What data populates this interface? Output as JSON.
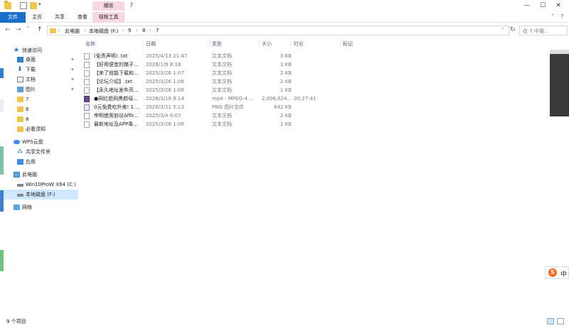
{
  "titlebar": {
    "context_tab": "播放",
    "title": "7",
    "min": "—",
    "max": "☐",
    "close": "✕"
  },
  "ribbon": {
    "tabs": [
      "文件",
      "主页",
      "共享",
      "查看",
      "视频工具"
    ],
    "collapse": "˅",
    "help": "?"
  },
  "address": {
    "back": "←",
    "forward": "→",
    "recent": "˅",
    "up": "↑",
    "crumbs": [
      "此电脑",
      "本地磁盘 (F:)",
      "9",
      "8",
      "7"
    ],
    "sep": "›",
    "dropdown": "˅",
    "refresh": "↻",
    "search_placeholder": "在 7 中搜..."
  },
  "nav": {
    "quick_access": "快速访问",
    "quick_items": [
      {
        "label": "桌面",
        "pinned": true
      },
      {
        "label": "下载",
        "pinned": true
      },
      {
        "label": "文档",
        "pinned": true
      },
      {
        "label": "图片",
        "pinned": true
      },
      {
        "label": "7",
        "pinned": false
      },
      {
        "label": "8",
        "pinned": false
      },
      {
        "label": "8",
        "pinned": false
      },
      {
        "label": "必看须知",
        "pinned": false
      }
    ],
    "pin_glyph": "📌",
    "wps_cloud": "WPS云盘",
    "shared_folder": "共享文件夹",
    "apps": "应用",
    "this_pc": "此电脑",
    "drive_c": "Win10ProW X64 (C:)",
    "drive_f": "本地磁盘 (F:)",
    "network": "网络"
  },
  "columns": [
    "名称",
    "日期",
    "类型",
    "大小",
    "时长",
    "标记"
  ],
  "files": [
    {
      "name": "(免责声明) .txt",
      "date": "2025/4/13 21:47",
      "type": "文本文档",
      "size": "3 KB",
      "duration": "",
      "icon": "txt"
    },
    {
      "name": "【好用便宜的梯子...",
      "date": "2026/1/9 8:18",
      "type": "文本文档",
      "size": "1 KB",
      "duration": "",
      "icon": "txt"
    },
    {
      "name": "【来了就能下载和...",
      "date": "2025/3/26 1:07",
      "type": "文本文档",
      "size": "2 KB",
      "duration": "",
      "icon": "txt"
    },
    {
      "name": "【论坛介绍】.txt",
      "date": "2025/3/26 1:08",
      "type": "文本文档",
      "size": "2 KB",
      "duration": "",
      "icon": "txt"
    },
    {
      "name": "【永久地址发布页...",
      "date": "2025/3/26 1:08",
      "type": "文本文档",
      "size": "1 KB",
      "duration": "",
      "icon": "txt"
    },
    {
      "name": "●网红脸网黑颜母...",
      "date": "2026/3/18 9:14",
      "type": "mp4 - MPEG-4 ...",
      "size": "2,006,624...",
      "duration": "00:27:41",
      "icon": "mp4"
    },
    {
      "name": "0元免费吃外卖! 1 ...",
      "date": "2026/3/11 5:13",
      "type": "PNG 图片文件",
      "size": "642 KB",
      "duration": "",
      "icon": "png"
    },
    {
      "name": "申明使用协议Affir...",
      "date": "2025/3/4 0:07",
      "type": "文本文档",
      "size": "2 KB",
      "duration": "",
      "icon": "txt"
    },
    {
      "name": "最新地址及APP毒...",
      "date": "2025/3/26 1:08",
      "type": "文本文档",
      "size": "1 KB",
      "duration": "",
      "icon": "txt"
    }
  ],
  "status": {
    "count": "9 个项目"
  },
  "ime": {
    "logo": "S",
    "label": "中"
  },
  "colors": {
    "accent": "#1a6fc9",
    "context_tab": "#f7d7e3",
    "selection": "#cde8ff"
  }
}
